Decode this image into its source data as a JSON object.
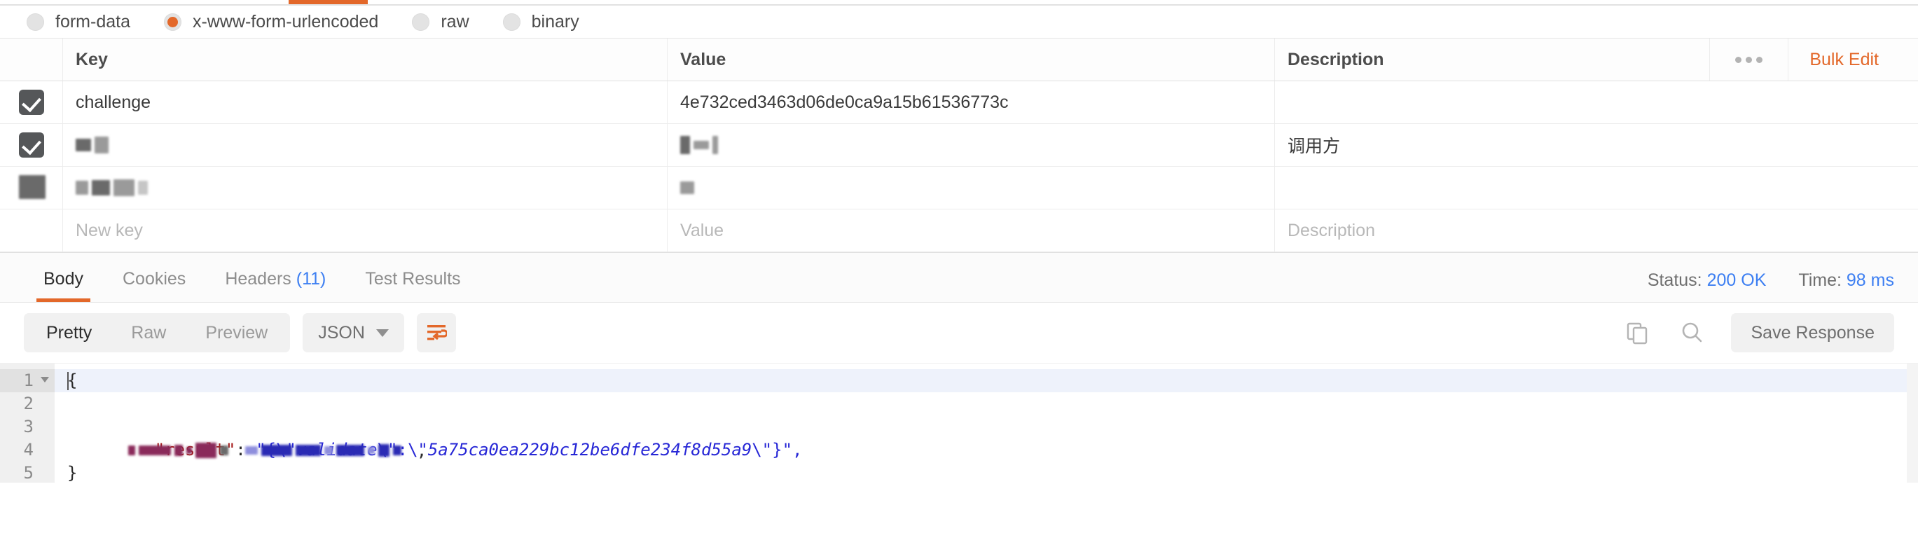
{
  "body_type": {
    "options": [
      {
        "label": "form-data",
        "selected": false
      },
      {
        "label": "x-www-form-urlencoded",
        "selected": true
      },
      {
        "label": "raw",
        "selected": false
      },
      {
        "label": "binary",
        "selected": false
      }
    ]
  },
  "params_table": {
    "columns": {
      "key": "Key",
      "value": "Value",
      "description": "Description"
    },
    "bulk_edit_label": "Bulk Edit",
    "rows": [
      {
        "checked": true,
        "key": "challenge",
        "value": "4e732ced3463d06de0ca9a15b61536773c",
        "description": ""
      },
      {
        "checked": true,
        "key": "",
        "value": "",
        "description": "调用方"
      },
      {
        "checked": true,
        "key": "",
        "value": "",
        "description": ""
      }
    ],
    "new_row": {
      "key_placeholder": "New key",
      "value_placeholder": "Value",
      "description_placeholder": "Description"
    }
  },
  "response": {
    "tabs": [
      {
        "label": "Body",
        "count": "",
        "active": true
      },
      {
        "label": "Cookies",
        "count": "",
        "active": false
      },
      {
        "label": "Headers",
        "count": "(11)",
        "active": false
      },
      {
        "label": "Test Results",
        "count": "",
        "active": false
      }
    ],
    "status_label": "Status:",
    "status_value": "200 OK",
    "time_label": "Time:",
    "time_value": "98 ms",
    "toolbar": {
      "view_modes": [
        {
          "label": "Pretty",
          "active": true
        },
        {
          "label": "Raw",
          "active": false
        },
        {
          "label": "Preview",
          "active": false
        }
      ],
      "format": "JSON",
      "save_response_label": "Save Response"
    },
    "code": {
      "line_numbers": [
        "1",
        "2",
        "3",
        "4",
        "5"
      ],
      "lines": [
        {
          "n": 1,
          "text": "{",
          "redacted": false
        },
        {
          "n": 2,
          "text": "",
          "redacted": true
        },
        {
          "n": 3,
          "text": "\"result\": \"{\\\"validate\\\":\\\"5a75ca0ea229bc12be6dfe234f8d55a9\\\"}\",",
          "redacted": false
        },
        {
          "n": 4,
          "text": "",
          "redacted": true
        },
        {
          "n": 5,
          "text": "}",
          "redacted": false
        }
      ],
      "result_key": "\"result\"",
      "result_sep": ": ",
      "result_open": "\"{\\\"",
      "result_field": "validate",
      "result_mid": "\\\":\\\"",
      "result_hash": "5a75ca0ea229bc12be6dfe234f8d55a9",
      "result_close": "\\\"}\",",
      "brace_open": "{",
      "brace_close": "}"
    }
  },
  "colors": {
    "accent": "#e3682a",
    "link": "#3d7ff2",
    "checkbox": "#555759",
    "string": "#2727d6",
    "key": "#a31515"
  }
}
